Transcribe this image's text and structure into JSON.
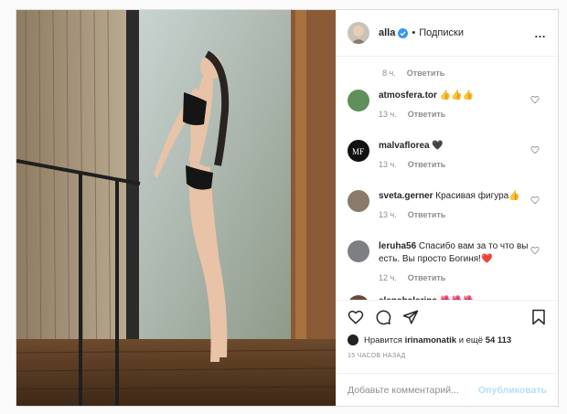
{
  "header": {
    "username": "alla",
    "dot": "•",
    "follow_label": "Подписки",
    "more": "…"
  },
  "top_meta": {
    "time": "8 ч.",
    "reply": "Ответить"
  },
  "comments": [
    {
      "user": "atmosfera.tor",
      "text": "👍👍👍",
      "time": "13 ч.",
      "reply": "Ответить",
      "avatar_color": "#5f8f5a"
    },
    {
      "user": "malvaflorea",
      "text": "🖤",
      "time": "13 ч.",
      "reply": "Ответить",
      "avatar_color": "#111111"
    },
    {
      "user": "sveta.gerner",
      "text": "Красивая фигура👍",
      "time": "13 ч.",
      "reply": "Ответить",
      "avatar_color": "#8a7a6a"
    },
    {
      "user": "leruha56",
      "text": "Спасибо вам за то что вы есть. Вы просто Богиня!❤️",
      "time": "12 ч.",
      "reply": "Ответить",
      "avatar_color": "#7d7f83"
    },
    {
      "user": "elenabalerina",
      "text": "🌺🌺🌺",
      "time": "",
      "reply": "",
      "avatar_color": "#6b4a3e"
    }
  ],
  "likes": {
    "prefix": "Нравится",
    "user": "irinamonatik",
    "middle": "и ещё",
    "count": "54 113"
  },
  "timestamp": "15 ЧАСОВ НАЗАД",
  "add_comment": {
    "placeholder": "Добавьте комментарий...",
    "publish_label": "Опубликовать"
  },
  "colors": {
    "verified": "#3897f0",
    "heart_outline": "#8e8e8e",
    "publish": "#b2dffc"
  }
}
